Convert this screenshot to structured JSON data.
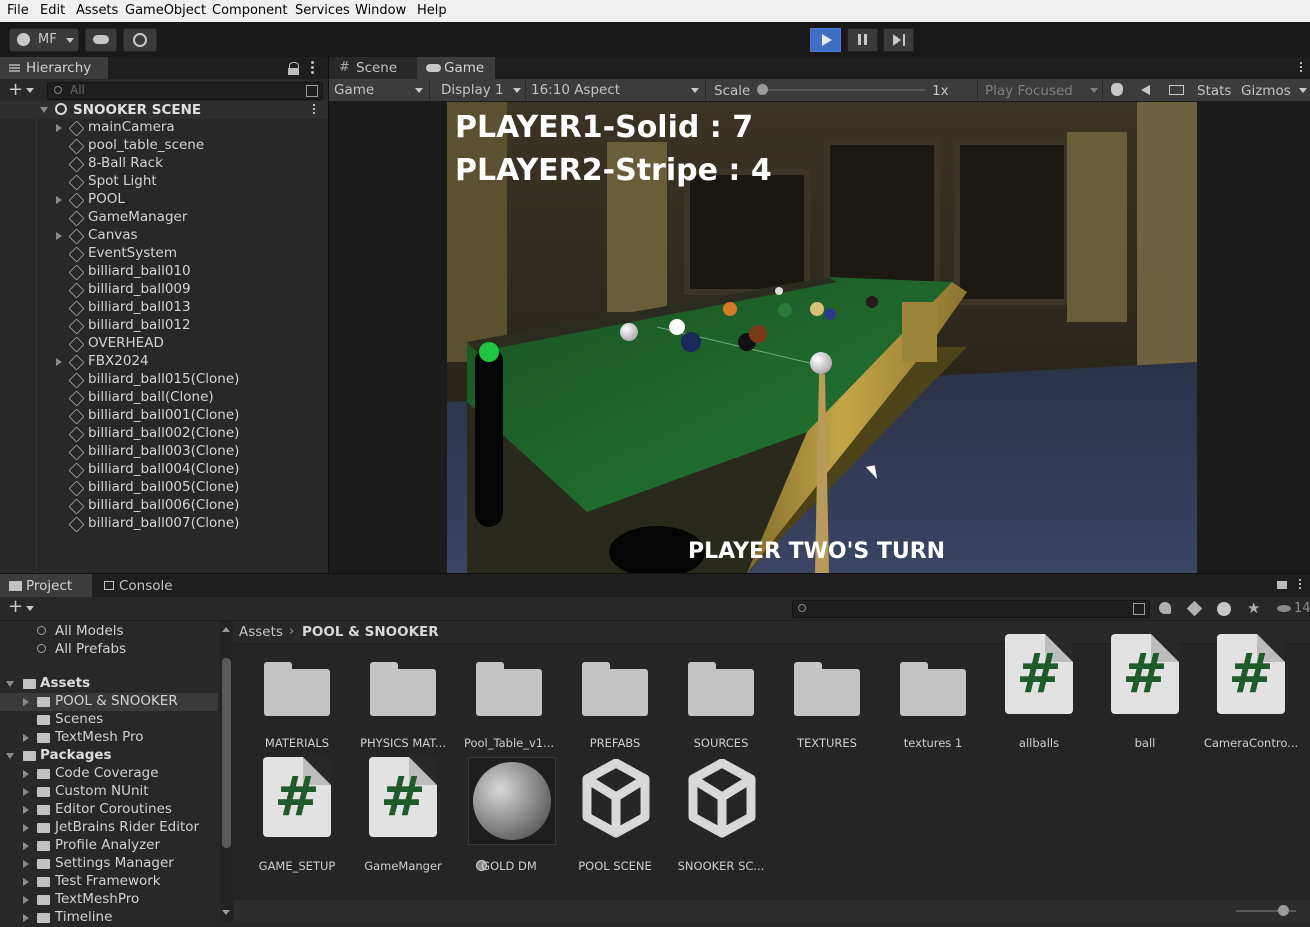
{
  "menu": [
    "File",
    "Edit",
    "Assets",
    "GameObject",
    "Component",
    "Services",
    "Window",
    "Help"
  ],
  "toolbar": {
    "account": "MF"
  },
  "hierarchy": {
    "title": "Hierarchy",
    "search_placeholder": "All",
    "scene": "SNOOKER SCENE",
    "items": [
      {
        "label": "mainCamera",
        "expandable": true
      },
      {
        "label": "pool_table_scene",
        "expandable": false
      },
      {
        "label": "8-Ball Rack",
        "expandable": false
      },
      {
        "label": "Spot Light",
        "expandable": false
      },
      {
        "label": "POOL",
        "expandable": true
      },
      {
        "label": "GameManager",
        "expandable": false
      },
      {
        "label": "Canvas",
        "expandable": true
      },
      {
        "label": "EventSystem",
        "expandable": false
      },
      {
        "label": "billiard_ball010",
        "expandable": false
      },
      {
        "label": "billiard_ball009",
        "expandable": false
      },
      {
        "label": "billiard_ball013",
        "expandable": false
      },
      {
        "label": "billiard_ball012",
        "expandable": false
      },
      {
        "label": "OVERHEAD",
        "expandable": false
      },
      {
        "label": "FBX2024",
        "expandable": true
      },
      {
        "label": "billiard_ball015(Clone)",
        "expandable": false
      },
      {
        "label": "billiard_ball(Clone)",
        "expandable": false
      },
      {
        "label": "billiard_ball001(Clone)",
        "expandable": false
      },
      {
        "label": "billiard_ball002(Clone)",
        "expandable": false
      },
      {
        "label": "billiard_ball003(Clone)",
        "expandable": false
      },
      {
        "label": "billiard_ball004(Clone)",
        "expandable": false
      },
      {
        "label": "billiard_ball005(Clone)",
        "expandable": false
      },
      {
        "label": "billiard_ball006(Clone)",
        "expandable": false
      },
      {
        "label": "billiard_ball007(Clone)",
        "expandable": false
      }
    ]
  },
  "tabs": {
    "scene": "Scene",
    "game": "Game"
  },
  "gamebar": {
    "mode": "Game",
    "display": "Display 1",
    "aspect": "16:10 Aspect",
    "scale_label": "Scale",
    "scale_value": "1x",
    "play_focused": "Play Focused",
    "stats": "Stats",
    "gizmos": "Gizmos"
  },
  "game": {
    "player1": "PLAYER1-Solid : 7",
    "player2": "PLAYER2-Stripe : 4",
    "turn": "PLAYER TWO'S TURN"
  },
  "project": {
    "tab_project": "Project",
    "tab_console": "Console",
    "favorites": [
      "All Models",
      "All Prefabs"
    ],
    "assets_root": "Assets",
    "assets_children": [
      "POOL & SNOOKER",
      "Scenes",
      "TextMesh Pro"
    ],
    "packages_root": "Packages",
    "packages": [
      "Code Coverage",
      "Custom NUnit",
      "Editor Coroutines",
      "JetBrains Rider Editor",
      "Profile Analyzer",
      "Settings Manager",
      "Test Framework",
      "TextMeshPro",
      "Timeline"
    ],
    "breadcrumb": [
      "Assets",
      "POOL & SNOOKER"
    ],
    "hidden_count": "14",
    "items": [
      {
        "label": "MATERIALS",
        "kind": "folder"
      },
      {
        "label": "PHYSICS MAT...",
        "kind": "folder"
      },
      {
        "label": "Pool_Table_v1...",
        "kind": "folder"
      },
      {
        "label": "PREFABS",
        "kind": "folder"
      },
      {
        "label": "SOURCES",
        "kind": "folder"
      },
      {
        "label": "TEXTURES",
        "kind": "folder"
      },
      {
        "label": "textures 1",
        "kind": "folder"
      },
      {
        "label": "allballs",
        "kind": "script"
      },
      {
        "label": "ball",
        "kind": "script"
      },
      {
        "label": "CameraContro...",
        "kind": "script"
      },
      {
        "label": "GAME_SETUP",
        "kind": "script"
      },
      {
        "label": "GameManger",
        "kind": "script"
      },
      {
        "label": "GOLD DM",
        "kind": "material"
      },
      {
        "label": "POOL SCENE",
        "kind": "scene"
      },
      {
        "label": "SNOOKER SC...",
        "kind": "scene"
      }
    ]
  },
  "colors": {
    "play_active": "#3f6ec4",
    "script_hash": "#1f5a2a",
    "felt": "#1d6b2a"
  }
}
